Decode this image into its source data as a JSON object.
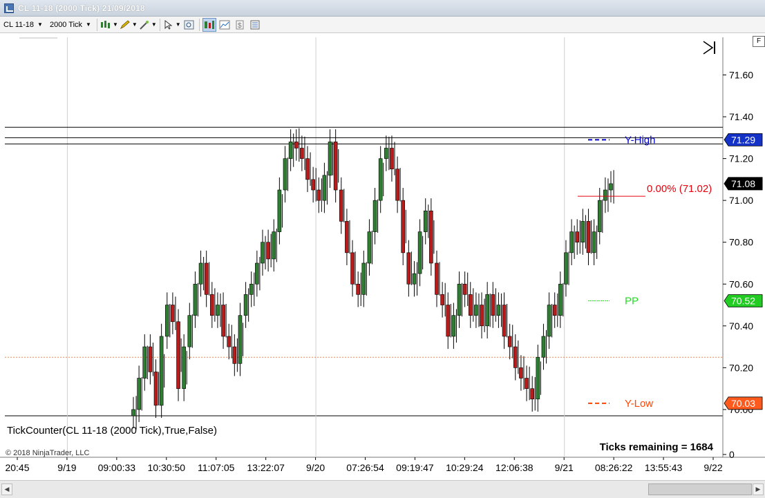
{
  "window": {
    "title": "CL 11-18 (2000 Tick)  21/09/2018",
    "corner_button": "F"
  },
  "toolbar": {
    "instrument": "CL 11-18",
    "interval": "2000 Tick",
    "tools": [
      {
        "icon": "bar-chart-style-icon",
        "dropdown": true,
        "active": false
      },
      {
        "icon": "pencil-draw-icon",
        "dropdown": true,
        "active": false
      },
      {
        "icon": "magic-wand-icon",
        "dropdown": true,
        "active": false
      },
      {
        "icon": "cursor-pointer-icon",
        "dropdown": true,
        "active": false
      },
      {
        "icon": "zoom-icon",
        "dropdown": false,
        "active": false
      },
      {
        "icon": "chart-trader-icon",
        "dropdown": false,
        "active": true
      },
      {
        "icon": "indicators-icon",
        "dropdown": false,
        "active": false
      },
      {
        "icon": "strategies-icon",
        "dropdown": false,
        "active": false
      },
      {
        "icon": "properties-icon",
        "dropdown": false,
        "active": false
      }
    ]
  },
  "chart_data": {
    "type": "candlestick",
    "y_axis": {
      "ticks": [
        "71.60",
        "71.40",
        "71.20",
        "71.00",
        "70.80",
        "70.60",
        "70.40",
        "70.20",
        "70.00"
      ],
      "ylim": [
        69.97,
        71.78
      ]
    },
    "x_axis": {
      "ticks": [
        "20:45",
        "9/19",
        "09:00:33",
        "10:30:50",
        "11:07:05",
        "13:22:07",
        "9/20",
        "07:26:54",
        "09:19:47",
        "10:29:24",
        "12:06:38",
        "9/21",
        "08:26:22",
        "13:55:43",
        "9/22"
      ]
    },
    "series": [
      {
        "type": "close",
        "values": [
          70.0,
          70.15,
          70.3,
          70.18,
          70.02,
          70.35,
          70.5,
          70.42,
          70.1,
          70.3,
          70.45,
          70.6,
          70.7,
          70.55,
          70.45,
          70.5,
          70.35,
          70.3,
          70.22,
          70.45,
          70.55,
          70.6,
          70.7,
          70.8,
          70.72,
          70.85,
          71.05,
          71.2,
          71.28,
          71.25,
          71.2,
          71.1,
          71.05,
          71.0,
          71.12,
          71.28,
          71.05,
          70.9,
          70.75,
          70.6,
          70.55,
          70.7,
          70.85,
          71.0,
          71.2,
          71.25,
          71.15,
          71.0,
          70.75,
          70.6,
          70.65,
          70.85,
          70.95,
          70.7,
          70.55,
          70.5,
          70.35,
          70.45,
          70.6,
          70.55,
          70.45,
          70.5,
          70.4,
          70.55,
          70.45,
          70.5,
          70.35,
          70.3,
          70.2,
          70.15,
          70.1,
          70.05,
          70.25,
          70.35,
          70.5,
          70.45,
          70.6,
          70.75,
          70.85,
          70.8,
          70.9,
          70.75,
          70.85,
          71.0,
          71.05,
          71.08
        ]
      }
    ],
    "levels": [
      {
        "name": "Y-High",
        "value": 71.29,
        "color": "#0000cc",
        "badge_color": "#1432c8"
      },
      {
        "name": "PP",
        "value": 70.52,
        "color": "#22dd22",
        "badge_color": "#22cc22"
      },
      {
        "name": "Y-Low",
        "value": 70.03,
        "color": "#ff4400",
        "badge_color": "#ff5a1e"
      }
    ],
    "last_price": {
      "value": 71.08,
      "label": "71.08"
    },
    "fib_label": "0.00% (71.02)",
    "fib_value": 71.02,
    "horizontal_lines": [
      71.35,
      71.3,
      71.27
    ],
    "dashed_level": 70.25
  },
  "indicator": {
    "name": "TickCounter(CL 11-18 (2000 Tick),True,False)",
    "status": "Ticks remaining = 1684",
    "axis_zero": "0"
  },
  "copyright": "© 2018 NinjaTrader, LLC",
  "colors": {
    "up": "#2e7d32",
    "down": "#b71c1c",
    "fib": "#e8000b"
  }
}
